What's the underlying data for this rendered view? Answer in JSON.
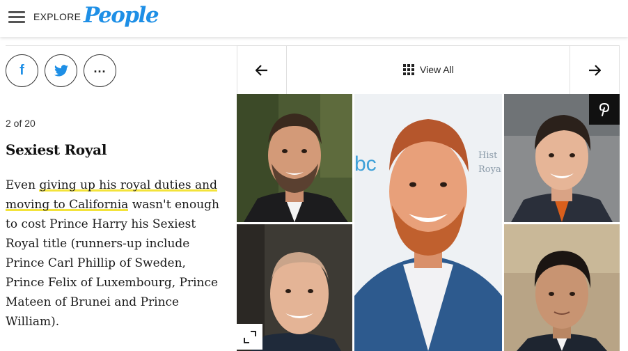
{
  "header": {
    "explore_label": "EXPLORE",
    "logo_text": "People",
    "brand_color": "#1e8fe6"
  },
  "share": {
    "facebook_icon": "facebook-icon",
    "twitter_icon": "twitter-icon",
    "more_icon": "more-icon",
    "more_glyph": "..."
  },
  "gallery": {
    "counter": "2 of 20",
    "title": "Sexiest Royal",
    "caption_link_1": "giving up his royal duties and",
    "caption_link_2": "moving to California",
    "caption_pre": "Even ",
    "caption_post": " wasn't enough to cost Prince Harry his Sexiest Royal title (runners-up include Prince Carl Phillip of Sweden, Prince Felix of Luxembourg, Prince Mateen of Brunei and Prince William).",
    "view_all_label": "View All",
    "highlight_color": "#f3e33a"
  },
  "photo": {
    "backdrop_text_1": "bc",
    "backdrop_text_2": "Hist",
    "backdrop_text_3": "Roya"
  }
}
